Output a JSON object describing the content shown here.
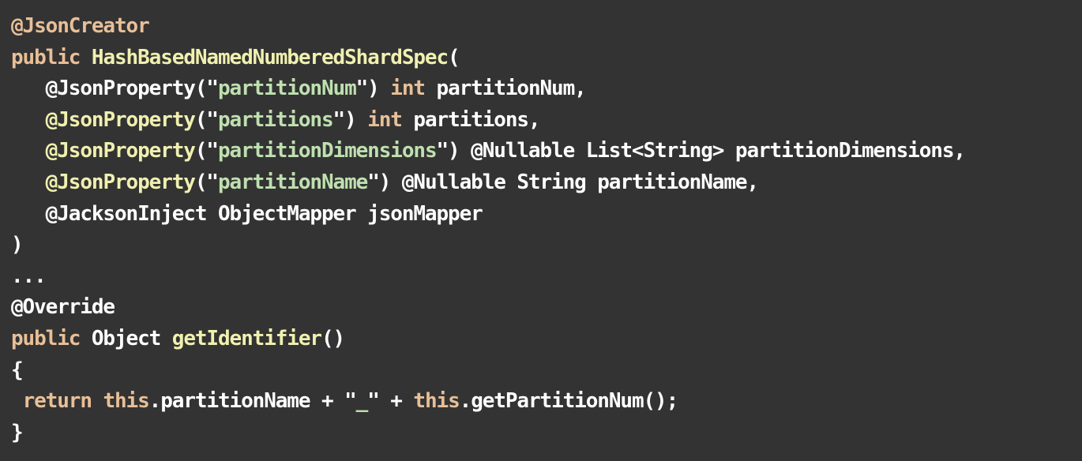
{
  "code": {
    "language": "Java",
    "lines": [
      [
        {
          "text": "@JsonCreator",
          "cls": "a"
        }
      ],
      [
        {
          "text": "public",
          "cls": "k"
        },
        {
          "text": " ",
          "cls": "p"
        },
        {
          "text": "HashBasedNamedNumberedShardSpec",
          "cls": "t"
        },
        {
          "text": "(",
          "cls": "p"
        }
      ],
      [
        {
          "text": "   ",
          "cls": "p"
        },
        {
          "text": "@JsonProperty(\"",
          "cls": "p"
        },
        {
          "text": "partitionNum",
          "cls": "s"
        },
        {
          "text": "\") ",
          "cls": "p"
        },
        {
          "text": "int",
          "cls": "k"
        },
        {
          "text": " partitionNum,",
          "cls": "p"
        }
      ],
      [
        {
          "text": "   ",
          "cls": "p"
        },
        {
          "text": "@JsonProperty",
          "cls": "t"
        },
        {
          "text": "(\"",
          "cls": "p"
        },
        {
          "text": "partitions",
          "cls": "s"
        },
        {
          "text": "\") ",
          "cls": "p"
        },
        {
          "text": "int",
          "cls": "k"
        },
        {
          "text": " partitions,",
          "cls": "p"
        }
      ],
      [
        {
          "text": "   ",
          "cls": "p"
        },
        {
          "text": "@JsonProperty",
          "cls": "t"
        },
        {
          "text": "(\"",
          "cls": "p"
        },
        {
          "text": "partitionDimensions",
          "cls": "s"
        },
        {
          "text": "\") @Nullable List<String> partitionDimensions,",
          "cls": "p"
        }
      ],
      [
        {
          "text": "   ",
          "cls": "p"
        },
        {
          "text": "@JsonProperty",
          "cls": "t"
        },
        {
          "text": "(\"",
          "cls": "p"
        },
        {
          "text": "partitionName",
          "cls": "s"
        },
        {
          "text": "\") @Nullable String partitionName,",
          "cls": "p"
        }
      ],
      [
        {
          "text": "   @JacksonInject ObjectMapper jsonMapper",
          "cls": "p"
        }
      ],
      [
        {
          "text": ")",
          "cls": "p"
        }
      ],
      [
        {
          "text": "...",
          "cls": "p"
        }
      ],
      [
        {
          "text": "@Override",
          "cls": "p"
        }
      ],
      [
        {
          "text": "public",
          "cls": "k"
        },
        {
          "text": " Object ",
          "cls": "p"
        },
        {
          "text": "getIdentifier",
          "cls": "m"
        },
        {
          "text": "()",
          "cls": "p"
        }
      ],
      [
        {
          "text": "{",
          "cls": "p"
        }
      ],
      [
        {
          "text": " ",
          "cls": "p"
        },
        {
          "text": "return",
          "cls": "k"
        },
        {
          "text": " ",
          "cls": "p"
        },
        {
          "text": "this",
          "cls": "k"
        },
        {
          "text": ".partitionName + \"",
          "cls": "p"
        },
        {
          "text": "_",
          "cls": "s"
        },
        {
          "text": "\" + ",
          "cls": "p"
        },
        {
          "text": "this",
          "cls": "k"
        },
        {
          "text": ".getPartitionNum();",
          "cls": "p"
        }
      ],
      [
        {
          "text": "}",
          "cls": "p"
        }
      ]
    ]
  },
  "colors": {
    "background": "#333333",
    "keyword": "#e8bf98",
    "type": "#f0f0b0",
    "string": "#bfe0b0",
    "plain": "#ffffff"
  }
}
